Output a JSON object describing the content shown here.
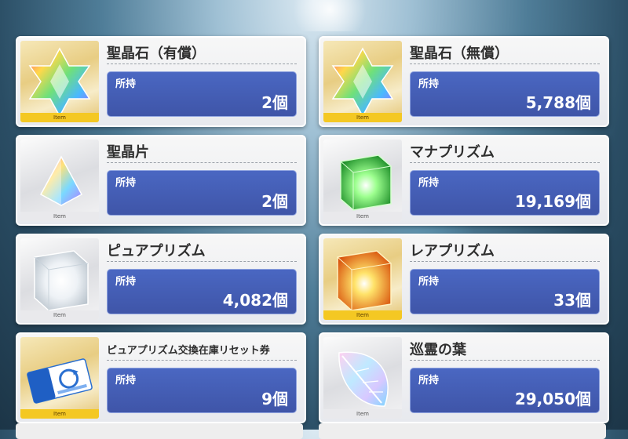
{
  "inventory": {
    "tag_label": "Item",
    "owned_label": "所持",
    "items": [
      {
        "name": "聖晶石（有償）",
        "count": "2個",
        "icon": "saint-quartz-icon"
      },
      {
        "name": "聖晶石（無償）",
        "count": "5,788個",
        "icon": "saint-quartz-icon"
      },
      {
        "name": "聖晶片",
        "count": "2個",
        "icon": "quartz-fragment-icon"
      },
      {
        "name": "マナプリズム",
        "count": "19,169個",
        "icon": "mana-prism-icon"
      },
      {
        "name": "ピュアプリズム",
        "count": "4,082個",
        "icon": "pure-prism-icon"
      },
      {
        "name": "レアプリズム",
        "count": "33個",
        "icon": "rare-prism-icon"
      },
      {
        "name": "ピュアプリズム交換在庫リセット券",
        "count": "9個",
        "icon": "reset-ticket-icon"
      },
      {
        "name": "巡霊の葉",
        "count": "29,050個",
        "icon": "spirit-leaf-icon"
      }
    ]
  },
  "colors": {
    "count_box": "#4560b8",
    "gold_frame": "#e8cd83",
    "item_tag": "#f4c823",
    "mana_prism": "#3ec23e",
    "rare_prism": "#f5a21a"
  }
}
